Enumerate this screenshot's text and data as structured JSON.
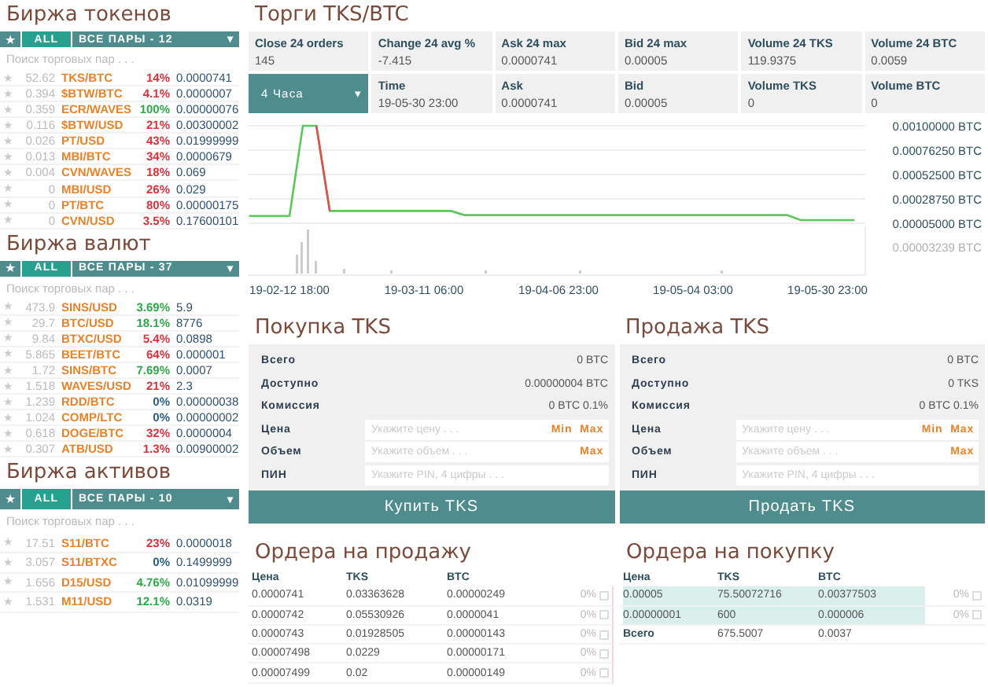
{
  "markets": [
    {
      "title": "Биржа токенов",
      "filter": {
        "star": "★",
        "all": {
          "label": "ALL",
          "selected": true
        },
        "dropdown": "ВСЕ ПАРЫ - 12",
        "caret": "▾"
      },
      "search": {
        "placeholder": "Поиск торговых пар . . ."
      },
      "rows": [
        {
          "star": "★",
          "volume": "52.62",
          "pair": "TKS/BTC",
          "change": "14%",
          "color": "#e0303a",
          "price": "0.0000741"
        },
        {
          "star": "★",
          "volume": "0.394",
          "pair": "$BTW/BTC",
          "change": "4.1%",
          "color": "#e0303a",
          "price": "0.0000007"
        },
        {
          "star": "★",
          "volume": "0.359",
          "pair": "ECR/WAVES",
          "change": "100%",
          "color": "#2fa84a",
          "price": "0.00000076"
        },
        {
          "star": "★",
          "volume": "0.116",
          "pair": "$BTW/USD",
          "change": "21%",
          "color": "#e0303a",
          "price": "0.00300002"
        },
        {
          "star": "★",
          "volume": "0.026",
          "pair": "PT/USD",
          "change": "43%",
          "color": "#e0303a",
          "price": "0.01999999"
        },
        {
          "star": "★",
          "volume": "0.013",
          "pair": "MBI/BTC",
          "change": "34%",
          "color": "#e0303a",
          "price": "0.0000679"
        },
        {
          "star": "★",
          "volume": "0.004",
          "pair": "CVN/WAVES",
          "change": "18%",
          "color": "#e0303a",
          "price": "0.069"
        },
        {
          "star": "★",
          "volume": "0",
          "pair": "MBI/USD",
          "change": "26%",
          "color": "#e0303a",
          "price": "0.029"
        },
        {
          "star": "★",
          "volume": "0",
          "pair": "PT/BTC",
          "change": "80%",
          "color": "#e0303a",
          "price": "0.00000175"
        },
        {
          "star": "★",
          "volume": "0",
          "pair": "CVN/USD",
          "change": "3.5%",
          "color": "#e0303a",
          "price": "0.17600101"
        }
      ]
    },
    {
      "title": "Биржа валют",
      "filter": {
        "star": "★",
        "all": {
          "label": "ALL",
          "selected": true
        },
        "dropdown": "ВСЕ ПАРЫ - 37",
        "caret": "▾"
      },
      "search": {
        "placeholder": "Поиск торговых пар . . ."
      },
      "rows": [
        {
          "star": "★",
          "volume": "473.9",
          "pair": "SINS/USD",
          "change": "3.69%",
          "color": "#2fa84a",
          "price": "5.9"
        },
        {
          "star": "★",
          "volume": "29.7",
          "pair": "BTC/USD",
          "change": "18.1%",
          "color": "#2fa84a",
          "price": "8776"
        },
        {
          "star": "★",
          "volume": "9.84",
          "pair": "BTXC/USD",
          "change": "5.4%",
          "color": "#e0303a",
          "price": "0.0898"
        },
        {
          "star": "★",
          "volume": "5.865",
          "pair": "BEET/BTC",
          "change": "64%",
          "color": "#e0303a",
          "price": "0.000001"
        },
        {
          "star": "★",
          "volume": "1.72",
          "pair": "SINS/BTC",
          "change": "7.69%",
          "color": "#2fa84a",
          "price": "0.0007"
        },
        {
          "star": "★",
          "volume": "1.518",
          "pair": "WAVES/USD",
          "change": "21%",
          "color": "#e0303a",
          "price": "2.3"
        },
        {
          "star": "★",
          "volume": "1.239",
          "pair": "RDD/BTC",
          "change": "0%",
          "color": "#2c5f86",
          "price": "0.00000038"
        },
        {
          "star": "★",
          "volume": "1.024",
          "pair": "COMP/LTC",
          "change": "0%",
          "color": "#2c5f86",
          "price": "0.00000002"
        },
        {
          "star": "★",
          "volume": "0.618",
          "pair": "DOGE/BTC",
          "change": "32%",
          "color": "#e0303a",
          "price": "0.0000004"
        },
        {
          "star": "★",
          "volume": "0.307",
          "pair": "ATB/USD",
          "change": "1.3%",
          "color": "#e0303a",
          "price": "0.00900002"
        }
      ]
    },
    {
      "title": "Биржа активов",
      "filter": {
        "star": "★",
        "all": {
          "label": "ALL",
          "selected": true
        },
        "dropdown": "ВСЕ ПАРЫ - 10",
        "caret": "▾"
      },
      "search": {
        "placeholder": "Поиск торговых пар . . ."
      },
      "rows": [
        {
          "star": "★",
          "volume": "17.51",
          "pair": "S11/BTC",
          "change": "23%",
          "color": "#e0303a",
          "price": "0.0000018"
        },
        {
          "star": "★",
          "volume": "3.057",
          "pair": "S11/BTXC",
          "change": "0%",
          "color": "#2c5f86",
          "price": "0.1499999"
        },
        {
          "star": "★",
          "volume": "1.656",
          "pair": "D15/USD",
          "change": "4.76%",
          "color": "#2fa84a",
          "price": "0.01099999"
        },
        {
          "star": "★",
          "volume": "1.531",
          "pair": "M11/USD",
          "change": "12.1%",
          "color": "#2fa84a",
          "price": "0.0319"
        }
      ]
    }
  ],
  "trade": {
    "title": "Торги TKS/BTC",
    "stats": [
      {
        "label": "Close 24 orders",
        "value": "145"
      },
      {
        "label": "Change 24 avg %",
        "value": "-7.415"
      },
      {
        "label": "Ask 24 max",
        "value": "0.0000741"
      },
      {
        "label": "Bid 24 max",
        "value": "0.00005"
      },
      {
        "label": "Volume 24 TKS",
        "value": "119.9375"
      },
      {
        "label": "Volume 24 BTC",
        "value": "0.0059"
      }
    ],
    "interval": {
      "value": "4 Часа",
      "caret": "▾"
    },
    "stats_2": [
      {
        "label": "Time",
        "value": "19-05-30 23:00"
      },
      {
        "label": "Ask",
        "value": "0.0000741"
      },
      {
        "label": "Bid",
        "value": "0.00005"
      },
      {
        "label": "Volume TKS",
        "value": "0"
      },
      {
        "label": "Volume BTC",
        "value": "0"
      }
    ],
    "chart_data": {
      "type": "line",
      "grid": true,
      "categories": [
        null,
        null,
        null,
        "19-02-12 18:00",
        null,
        null,
        null,
        null,
        null,
        null,
        null,
        null,
        null,
        "19-03-11 06:00",
        null,
        null,
        null,
        null,
        null,
        null,
        null,
        null,
        null,
        "19-04-06 23:00",
        null,
        null,
        null,
        null,
        null,
        null,
        null,
        null,
        null,
        "19-05-04 03:00",
        null,
        null,
        null,
        null,
        null,
        null,
        null,
        null,
        null,
        "19-05-30 23:00",
        null,
        null
      ],
      "series": [
        {
          "color": "#5cc85c",
          "values": [
            0.00012,
            0.00012,
            0.00012,
            0.00012,
            0.001,
            0.001,
            0.00017,
            0.00017,
            0.00017,
            0.00017,
            0.00017,
            0.00017,
            0.00017,
            0.00017,
            0.00017,
            0.00017,
            0.00013,
            0.00013,
            0.00013,
            0.00013,
            0.00013,
            0.00013,
            0.00013,
            0.00013,
            0.00013,
            0.00013,
            0.00013,
            0.00013,
            0.00013,
            0.00013,
            0.00013,
            0.00013,
            0.00013,
            0.00013,
            0.00013,
            0.00013,
            0.00013,
            0.00013,
            0.00013,
            0.00013,
            0.00013,
            8e-05,
            8e-05,
            8e-05,
            8e-05,
            8e-05
          ]
        },
        {
          "color": "#e05050",
          "values": [
            null,
            null,
            null,
            null,
            null,
            0.001,
            0.00017,
            null,
            null,
            null,
            null,
            null,
            null,
            null,
            null,
            null,
            null,
            null,
            null,
            null,
            null,
            null,
            null,
            null,
            null,
            null,
            null,
            null,
            null,
            null,
            null,
            null,
            null,
            null,
            null,
            null,
            null,
            null,
            null,
            null,
            null,
            null,
            null,
            null,
            null,
            null
          ]
        }
      ],
      "ylim": [
        5e-05,
        0.001
      ],
      "yticks": [
        {
          "value": 0.001,
          "label": "0.00100000 BTC"
        },
        {
          "value": 0.0007625,
          "label": "0.00076250 BTC"
        },
        {
          "value": 0.000525,
          "label": "0.00052500 BTC"
        },
        {
          "value": 0.0002875,
          "label": "0.00028750 BTC"
        },
        {
          "value": 5e-05,
          "label": "0.00005000 BTC"
        }
      ]
    },
    "volume_label": "0.00003239 BTC"
  },
  "forms": [
    {
      "title": "Покупка TKS",
      "info": [
        {
          "label": "Всего",
          "value": "0 BTC"
        },
        {
          "label": "Доступно",
          "value": "0.00000004 BTC"
        },
        {
          "label": "Комиссия",
          "value": "0 BTC 0.1%"
        }
      ],
      "inputs": [
        {
          "label": "Цена",
          "placeholder": "Укажите цену . . .",
          "links": [
            "Min",
            "Max"
          ]
        },
        {
          "label": "Объем",
          "placeholder": "Укажите объем . . .",
          "links": [
            "Max"
          ]
        },
        {
          "label": "ПИН",
          "placeholder": "Укажите PIN, 4 цифры . . ."
        }
      ],
      "button": "Купить TKS"
    },
    {
      "title": "Продажа TKS",
      "info": [
        {
          "label": "Всего",
          "value": "0 BTC"
        },
        {
          "label": "Доступно",
          "value": "0 TKS"
        },
        {
          "label": "Комиссия",
          "value": "0 BTC 0.1%"
        }
      ],
      "inputs": [
        {
          "label": "Цена",
          "placeholder": "Укажите цену . . .",
          "links": [
            "Min",
            "Max"
          ]
        },
        {
          "label": "Объем",
          "placeholder": "Укажите объем . . .",
          "links": [
            "Max"
          ]
        },
        {
          "label": "ПИН",
          "placeholder": "Укажите PIN, 4 цифры . . ."
        }
      ],
      "button": "Продать TKS"
    }
  ],
  "orders": [
    {
      "title": "Ордера на продажу",
      "columns": [
        "Цена",
        "TKS",
        "BTC"
      ],
      "rows": [
        {
          "cells": [
            "0.0000741",
            "0.03363628",
            "0.00000249"
          ],
          "share": "0%",
          "selected": false,
          "checked": false
        },
        {
          "cells": [
            "0.0000742",
            "0.05530926",
            "0.0000041"
          ],
          "share": "0%",
          "selected": false,
          "checked": false
        },
        {
          "cells": [
            "0.0000743",
            "0.01928505",
            "0.00000143"
          ],
          "share": "0%",
          "selected": false,
          "checked": false
        },
        {
          "cells": [
            "0.00007498",
            "0.0229",
            "0.00000171"
          ],
          "share": "0%",
          "selected": false,
          "checked": false
        },
        {
          "cells": [
            "0.00007499",
            "0.02",
            "0.00000149"
          ],
          "share": "0%",
          "selected": false,
          "checked": false
        }
      ]
    },
    {
      "title": "Ордера на покупку",
      "columns": [
        "Цена",
        "TKS",
        "BTC"
      ],
      "rows": [
        {
          "cells": [
            "0.00005",
            "75.50072716",
            "0.00377503"
          ],
          "share": "0%",
          "selected": true,
          "checked": false
        },
        {
          "cells": [
            "0.00000001",
            "600",
            "0.000006"
          ],
          "share": "0%",
          "selected": true,
          "checked": false
        }
      ],
      "total": {
        "label": "Всего",
        "cells": [
          "675.5007",
          "0.0037"
        ]
      }
    }
  ]
}
